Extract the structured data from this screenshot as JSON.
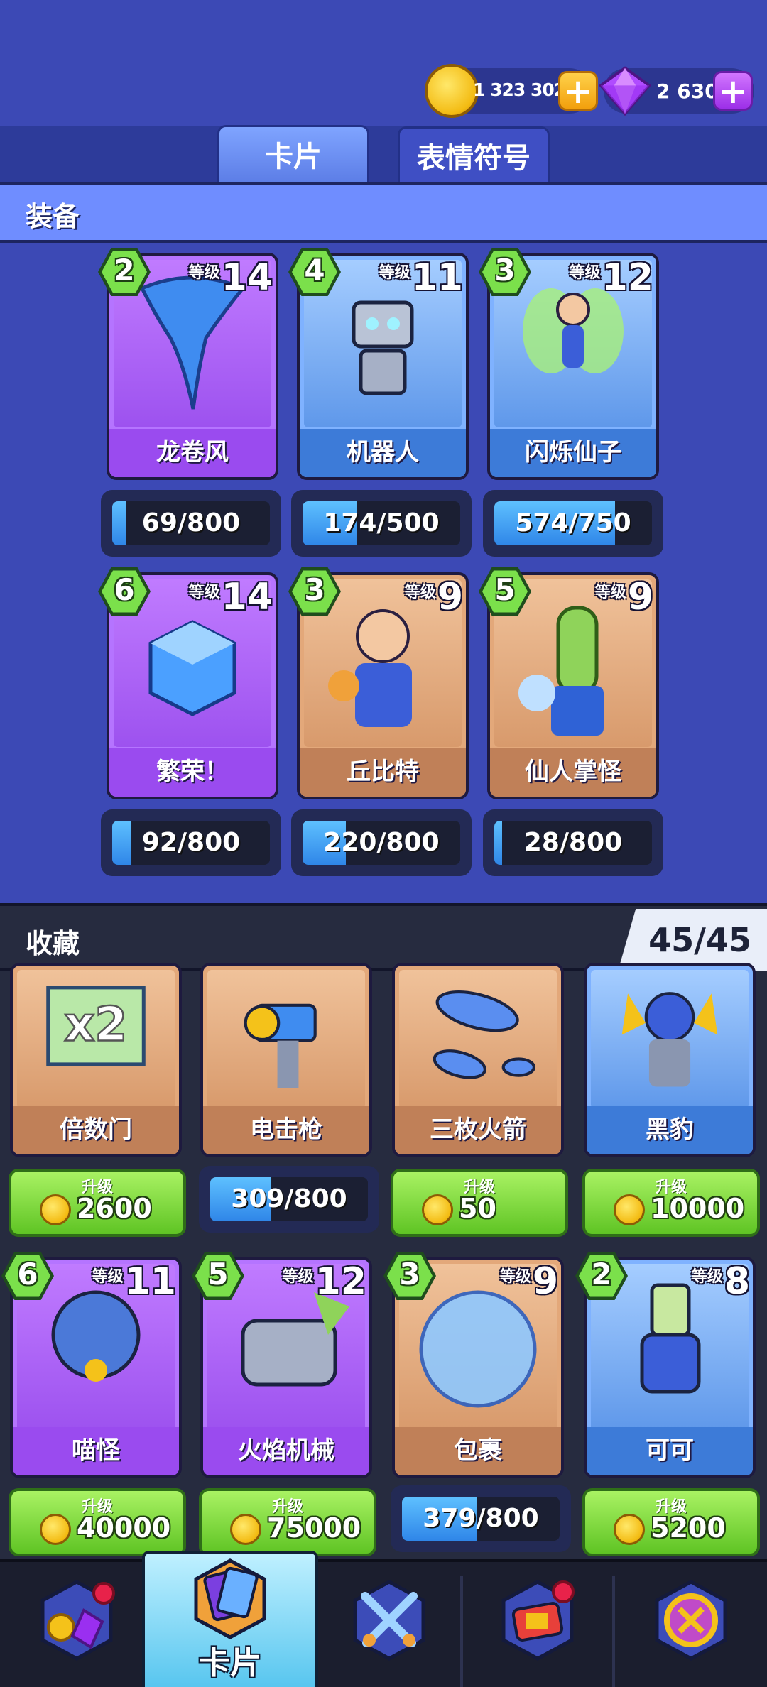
{
  "header": {
    "coins": "1 323 302",
    "gems": "2 630"
  },
  "tabs": [
    "卡片",
    "表情符号"
  ],
  "sections": {
    "equipment": "装备",
    "collection": "收藏",
    "collection_count": "45/45"
  },
  "equipment": [
    {
      "name": "龙卷风",
      "count": "2",
      "level_label": "等级",
      "level": "14",
      "progress": "69/800",
      "fraction": 0.086,
      "rarity": "purple"
    },
    {
      "name": "机器人",
      "count": "4",
      "level_label": "等级",
      "level": "11",
      "progress": "174/500",
      "fraction": 0.348,
      "rarity": "blue"
    },
    {
      "name": "闪烁仙子",
      "count": "3",
      "level_label": "等级",
      "level": "12",
      "progress": "574/750",
      "fraction": 0.765,
      "rarity": "blue"
    },
    {
      "name": "繁荣！",
      "count": "6",
      "level_label": "等级",
      "level": "14",
      "progress": "92/800",
      "fraction": 0.115,
      "rarity": "purple"
    },
    {
      "name": "丘比特",
      "count": "3",
      "level_label": "等级",
      "level": "9",
      "progress": "220/800",
      "fraction": 0.275,
      "rarity": "brown"
    },
    {
      "name": "仙人掌怪",
      "count": "5",
      "level_label": "等级",
      "level": "9",
      "progress": "28/800",
      "fraction": 0.035,
      "rarity": "brown"
    }
  ],
  "collection_row1": [
    {
      "name": "倍数门",
      "art_text": "x2",
      "rarity": "brown",
      "action": "upgrade",
      "upgrade_label": "升级",
      "cost": "2600"
    },
    {
      "name": "电击枪",
      "rarity": "brown",
      "action": "progress",
      "progress": "309/800",
      "fraction": 0.386
    },
    {
      "name": "三枚火箭",
      "rarity": "brown",
      "action": "upgrade",
      "upgrade_label": "升级",
      "cost": "50"
    },
    {
      "name": "黑豹",
      "rarity": "blue",
      "action": "upgrade",
      "upgrade_label": "升级",
      "cost": "10000"
    }
  ],
  "collection_row2": [
    {
      "name": "喵怪",
      "count": "6",
      "level_label": "等级",
      "level": "11",
      "rarity": "purple",
      "action": "upgrade",
      "upgrade_label": "升级",
      "cost": "40000"
    },
    {
      "name": "火焰机械",
      "count": "5",
      "level_label": "等级",
      "level": "12",
      "rarity": "purple",
      "action": "upgrade",
      "upgrade_label": "升级",
      "cost": "75000"
    },
    {
      "name": "包裹",
      "count": "3",
      "level_label": "等级",
      "level": "9",
      "rarity": "brown",
      "action": "progress",
      "progress": "379/800",
      "fraction": 0.474
    },
    {
      "name": "可可",
      "count": "2",
      "level_label": "等级",
      "level": "8",
      "rarity": "blue",
      "action": "upgrade",
      "upgrade_label": "升级",
      "cost": "5200"
    }
  ],
  "nav": {
    "items": [
      "shop-icon",
      "cards-icon",
      "battle-icon",
      "clan-icon",
      "trophy-icon"
    ],
    "active_label": "卡片"
  }
}
